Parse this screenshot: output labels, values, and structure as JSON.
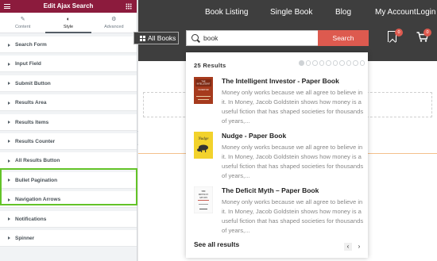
{
  "panel": {
    "title": "Edit Ajax Search",
    "tabs": [
      {
        "label": "Content",
        "icon": "pencil-icon"
      },
      {
        "label": "Style",
        "icon": "half-circle-icon"
      },
      {
        "label": "Advanced",
        "icon": "gear-icon"
      }
    ],
    "active_tab": "Style",
    "sections": [
      "Search Form",
      "Input Field",
      "Submit Button",
      "Results Area",
      "Results Items",
      "Results Counter",
      "All Results Button",
      "Bullet Pagination",
      "Navigation Arrows",
      "Notifications",
      "Spinner"
    ],
    "highlight_color": "#63c328",
    "header_color": "#8c1b3d"
  },
  "nav": {
    "items": [
      "Book Listing",
      "Single Book",
      "Blog",
      "My Account",
      "Login"
    ]
  },
  "header": {
    "all_books_label": "All Books",
    "search_value": "book",
    "search_button": "Search",
    "wishlist_count": "0",
    "cart_count": "0",
    "accent_color": "#dd5a4f",
    "bg_color": "#3e3e3e"
  },
  "results": {
    "count_label": "25 Results",
    "bullets_total": 10,
    "bullets_active": 1,
    "items": [
      {
        "title": "The Intelligent Investor - Paper Book",
        "description": "Money only works because we all agree to believe in it. In Money, Jacob Goldstein shows how money is a useful fiction that has shaped societies for thousands of years,...",
        "cover_text": "THE INTELLIGENT INVESTOR"
      },
      {
        "title": "Nudge - Paper Book",
        "description": "Money only works because we all agree to believe in it. In Money, Jacob Goldstein shows how money is a useful fiction that has shaped societies for thousands of years,...",
        "cover_text": "Nudge"
      },
      {
        "title": "The Deficit Myth – Paper Book",
        "description": "Money only works because we all agree to believe in it. In Money, Jacob Goldstein shows how money is a useful fiction that has shaped societies for thousands of years,...",
        "cover_text": "DEFICIT MYTH"
      }
    ],
    "see_all_label": "See all results",
    "prev_icon": "‹",
    "next_icon": "›"
  }
}
